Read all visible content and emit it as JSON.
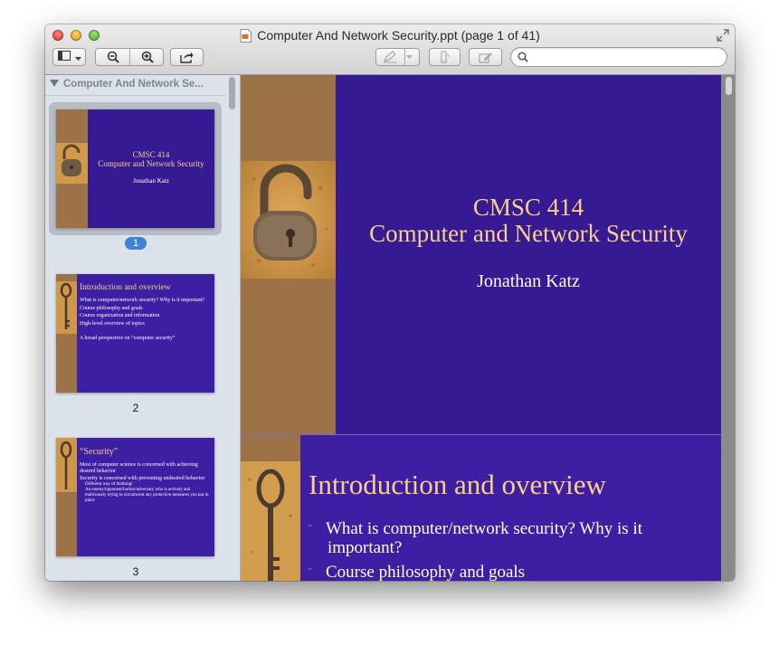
{
  "window": {
    "title": "Computer And Network Security.ppt (page 1 of 41)"
  },
  "toolbar": {
    "sidebar_button_icon": "sidebar-icon",
    "zoom_out_icon": "zoom-out-icon",
    "zoom_in_icon": "zoom-in-icon",
    "share_icon": "share-icon",
    "annotate_icon": "pen-icon",
    "rotate_icon": "rotate-icon",
    "edit_icon": "edit-icon",
    "search_placeholder": ""
  },
  "sidebar": {
    "header": "Computer And Network Se...",
    "thumbnails": [
      {
        "page_label": "1",
        "title_line1": "CMSC 414",
        "title_line2": "Computer and Network Security",
        "author": "Jonathan Katz"
      },
      {
        "page_label": "2",
        "title": "Introduction and overview",
        "bullets": [
          "What is computer/network security? Why is it important?",
          "Course philosophy and goals",
          "Course organization and information",
          "High-level overview of topics",
          "A broad perspective on “computer security”"
        ]
      },
      {
        "page_label": "3",
        "title": "“Security”",
        "bullets": [
          "Most of computer science is concerned with achieving desired behavior",
          "Security is concerned with preventing undesired behavior",
          "Different way of thinking!",
          "An enemy/opponent/hacker/adversary who is actively and maliciously trying to circumvent any protective measures you put in place"
        ]
      }
    ]
  },
  "main": {
    "slide1": {
      "title_line1": "CMSC 414",
      "title_line2": "Computer and Network Security",
      "author": "Jonathan Katz"
    },
    "slide2": {
      "title": "Introduction and overview",
      "bullet1_line1": "What is computer/network security? Why is it",
      "bullet1_line2": "important?",
      "bullet2": "Course philosophy and goals"
    }
  },
  "colors": {
    "slide_background": "#361a93",
    "slide_accent_strip": "#9e7247",
    "title_gold": "#f9cf8a",
    "selection_badge": "#3f82d9"
  }
}
